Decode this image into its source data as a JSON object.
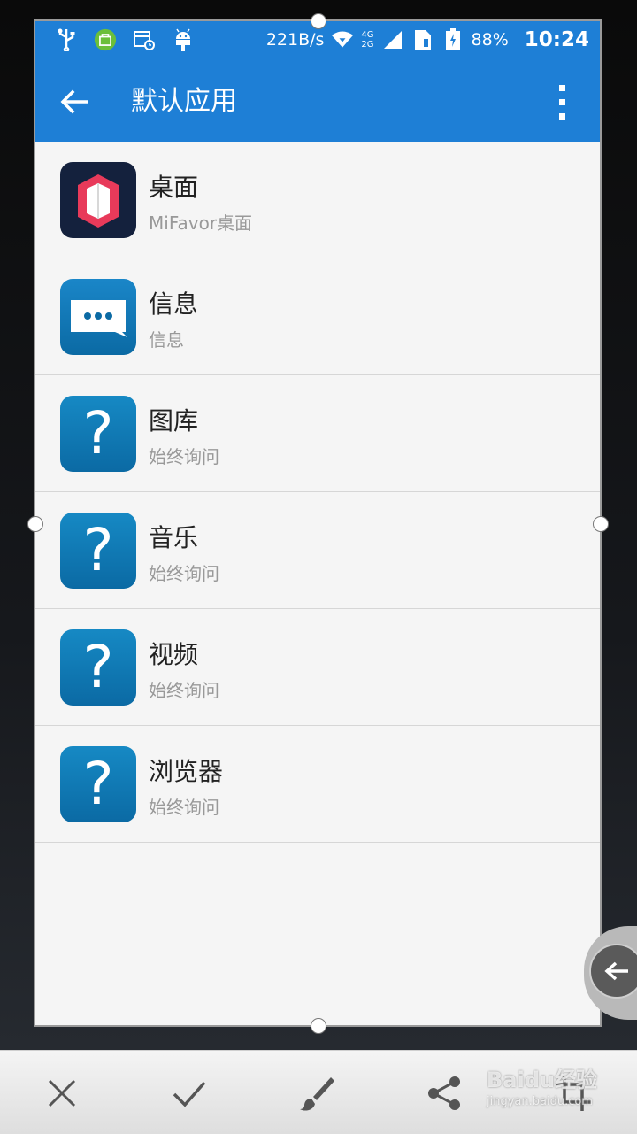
{
  "status_bar": {
    "net_speed": "221B/s",
    "network_label_top": "4G",
    "network_label_bottom": "2G",
    "battery": "88%",
    "time": "10:24"
  },
  "app_bar": {
    "title": "默认应用",
    "back_icon": "arrow-left-icon",
    "menu_icon": "more-vert-icon"
  },
  "list": [
    {
      "title": "桌面",
      "subtitle": "MiFavor桌面",
      "icon": "launcher-icon"
    },
    {
      "title": "信息",
      "subtitle": "信息",
      "icon": "message-icon"
    },
    {
      "title": "图库",
      "subtitle": "始终询问",
      "icon": "question-icon"
    },
    {
      "title": "音乐",
      "subtitle": "始终询问",
      "icon": "question-icon"
    },
    {
      "title": "视频",
      "subtitle": "始终询问",
      "icon": "question-icon"
    },
    {
      "title": "浏览器",
      "subtitle": "始终询问",
      "icon": "question-icon"
    }
  ],
  "question_glyph": "?",
  "bottom_toolbar": [
    "close-icon",
    "check-icon",
    "brush-icon",
    "share-icon",
    "crop-icon"
  ],
  "watermark": {
    "brand": "Baidu经验",
    "url": "jingyan.baidu.com"
  },
  "colors": {
    "accent": "#1e7fd6",
    "icon_blue": "#0b6aa4",
    "launcher_red": "#e83a5a"
  }
}
